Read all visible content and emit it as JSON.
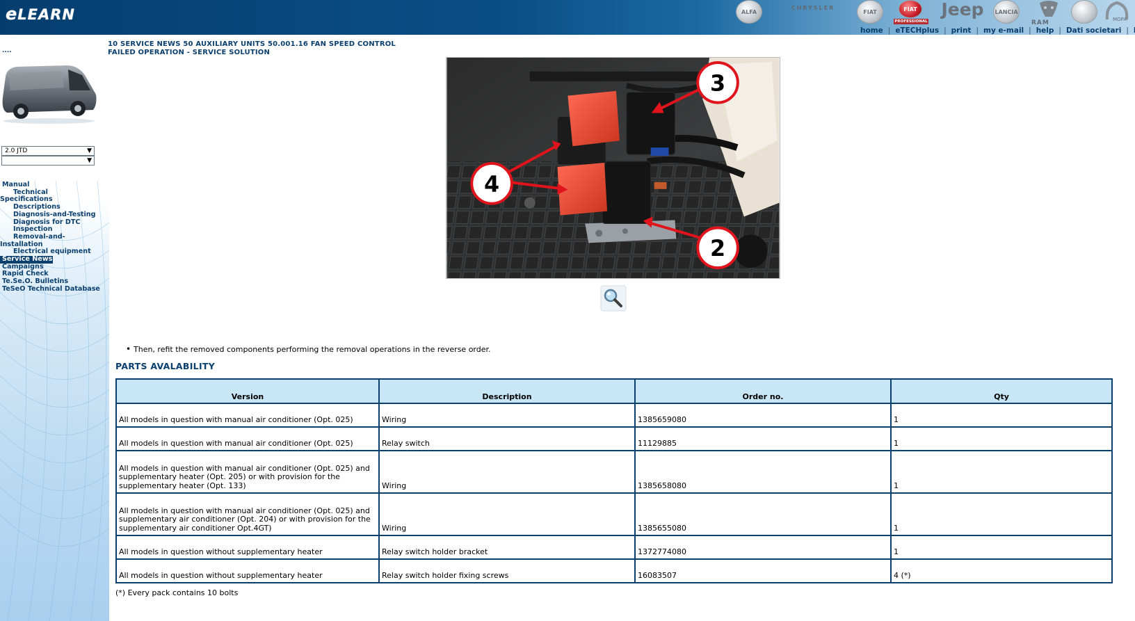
{
  "header": {
    "logo_prefix": "e",
    "logo_text": "LEARN",
    "brands": [
      {
        "name": "alfa-romeo",
        "label": "ALFA"
      },
      {
        "name": "chrysler",
        "label": "CHRYSLER"
      },
      {
        "name": "fiat",
        "label": "FIAT"
      },
      {
        "name": "fiat-professional",
        "label": "FIAT"
      },
      {
        "name": "jeep",
        "label": "Jeep"
      },
      {
        "name": "lancia",
        "label": "LANCIA"
      },
      {
        "name": "ram",
        "label": "RAM"
      },
      {
        "name": "abarth",
        "label": ""
      }
    ],
    "fiat_pro_caption": "PROFESSIONAL",
    "mopar_label": "MOPA",
    "nav": [
      "home",
      "eTECHplus",
      "print",
      "my e-mail",
      "help",
      "Dati societari",
      "log"
    ]
  },
  "sidebar": {
    "dots": "....",
    "model_select": "2.0 JTD",
    "second_select": "",
    "menu": [
      {
        "label": "Manual",
        "level": 0
      },
      {
        "label": "Technical",
        "level": 1
      },
      {
        "label": "Specifications",
        "level": 2
      },
      {
        "label": "Descriptions",
        "level": 1
      },
      {
        "label": "Diagnosis-and-Testing",
        "level": 1
      },
      {
        "label": "Diagnosis for DTC",
        "level": 1
      },
      {
        "label": "Inspection",
        "level": 1
      },
      {
        "label": "Removal-and-",
        "level": 1
      },
      {
        "label": "Installation",
        "level": 2
      },
      {
        "label": "Electrical equipment",
        "level": 1
      },
      {
        "label": "Service News",
        "level": 0,
        "active": true
      },
      {
        "label": "Campaigns",
        "level": 0
      },
      {
        "label": "Rapid Check",
        "level": 0
      },
      {
        "label": "Te.Se.O. Bulletins",
        "level": 0
      },
      {
        "label": "TeSeO Technical Database",
        "level": 0
      }
    ]
  },
  "main": {
    "breadcrumb_line1": "10 SERVICE NEWS 50 AUXILIARY UNITS 50.001.16 FAN SPEED CONTROL",
    "breadcrumb_line2": "FAILED OPERATION - SERVICE SOLUTION",
    "figure_callouts": [
      "3",
      "4",
      "2"
    ],
    "instruction": "Then, refit the removed components performing the removal operations in the reverse order.",
    "parts_heading": "PARTS AVALABILITY",
    "table_headers": [
      "Version",
      "Description",
      "Order no.",
      "Qty"
    ],
    "table_rows": [
      {
        "version": "All models in question with manual air conditioner (Opt. 025)",
        "description": "Wiring",
        "order_no": "1385659080",
        "qty": "1"
      },
      {
        "version": "All models in question with manual air conditioner (Opt. 025)",
        "description": "Relay switch",
        "order_no": "11129885",
        "qty": "1"
      },
      {
        "version_lines": [
          "All models in question with manual air conditioner (Opt. 025) and",
          "supplementary heater (Opt. 205) or with provision for the",
          "supplementary heater (Opt. 133)"
        ],
        "description": "Wiring",
        "order_no": "1385658080",
        "qty": "1"
      },
      {
        "version_lines": [
          "All models in question with manual air conditioner (Opt. 025) and",
          "supplementary air conditioner (Opt. 204) or with provision for the",
          "supplementary air conditioner Opt.4GT)"
        ],
        "description": "Wiring",
        "order_no": "1385655080",
        "qty": "1"
      },
      {
        "version": "All models in question without supplementary heater",
        "description": "Relay switch holder bracket",
        "order_no": "1372774080",
        "qty": "1"
      },
      {
        "version": "All models in question without supplementary heater",
        "description": "Relay switch holder fixing screws",
        "order_no": "16083507",
        "qty": "4 (*)"
      }
    ],
    "footnote": "(*) Every pack contains 10 bolts"
  }
}
